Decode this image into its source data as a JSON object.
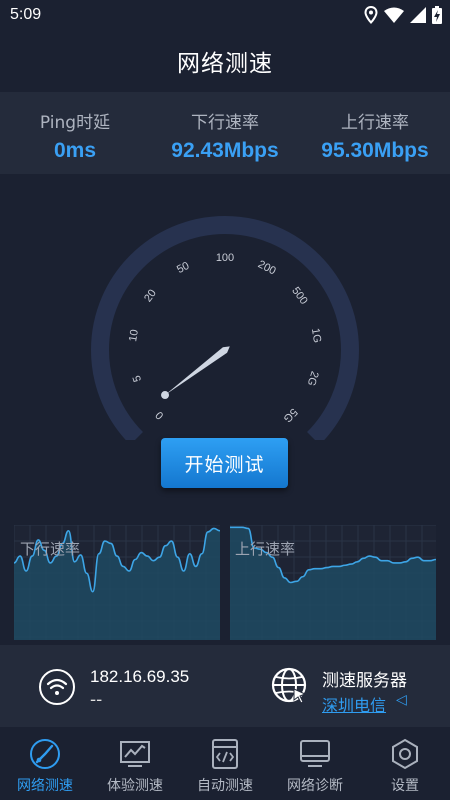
{
  "status_bar": {
    "time": "5:09",
    "icons": [
      "location-icon",
      "wifi-icon",
      "signal-icon",
      "battery-charging-icon"
    ]
  },
  "header": {
    "title": "网络测速"
  },
  "stats": [
    {
      "label": "Ping时延",
      "value": "0ms"
    },
    {
      "label": "下行速率",
      "value": "92.43Mbps"
    },
    {
      "label": "上行速率",
      "value": "95.30Mbps"
    }
  ],
  "gauge": {
    "ticks": [
      "0",
      "5",
      "10",
      "20",
      "50",
      "100",
      "200",
      "500",
      "1G",
      "2G",
      "5G"
    ],
    "needle_value": 0.3,
    "colors": {
      "arc": "#27324f",
      "needle": "#cfd6e2",
      "tick_text": "#c8ccd6"
    }
  },
  "start_button": {
    "label": "开始测试"
  },
  "charts": {
    "download": {
      "label": "下行速率",
      "values": [
        0.67,
        0.73,
        0.6,
        0.73,
        0.87,
        0.78,
        0.67,
        0.73,
        0.84,
        0.95,
        0.68,
        0.74,
        0.58,
        0.42,
        0.75,
        0.86,
        0.84,
        0.73,
        0.64,
        0.6,
        0.7,
        0.76,
        0.73,
        0.69,
        0.72,
        0.82,
        0.86,
        0.72,
        0.6,
        0.75,
        0.64,
        0.75,
        0.94,
        0.97,
        0.95
      ]
    },
    "upload": {
      "label": "上行速率",
      "values": [
        0.98,
        0.98,
        0.98,
        0.97,
        0.8,
        0.79,
        0.76,
        0.72,
        0.63,
        0.54,
        0.5,
        0.51,
        0.55,
        0.61,
        0.62,
        0.62,
        0.63,
        0.64,
        0.64,
        0.65,
        0.66,
        0.68,
        0.71,
        0.73,
        0.72,
        0.69,
        0.69,
        0.67,
        0.67,
        0.68,
        0.71,
        0.72,
        0.69,
        0.69,
        0.7
      ]
    },
    "colors": {
      "line": "#3da5e6",
      "fill": "#1f4a63",
      "grid": "#2a3446"
    }
  },
  "network_info": {
    "ip": "182.16.69.35",
    "sub": "--",
    "server_title": "测速服务器",
    "server_name": "深圳电信",
    "server_caret": "◁"
  },
  "tabs": [
    {
      "label": "网络测速",
      "icon": "speedometer-icon",
      "active": true
    },
    {
      "label": "体验测速",
      "icon": "chart-monitor-icon",
      "active": false
    },
    {
      "label": "自动测速",
      "icon": "code-file-icon",
      "active": false
    },
    {
      "label": "网络诊断",
      "icon": "monitor-icon",
      "active": false
    },
    {
      "label": "设置",
      "icon": "hexagon-settings-icon",
      "active": false
    }
  ],
  "accent_color": "#2f9cf0"
}
